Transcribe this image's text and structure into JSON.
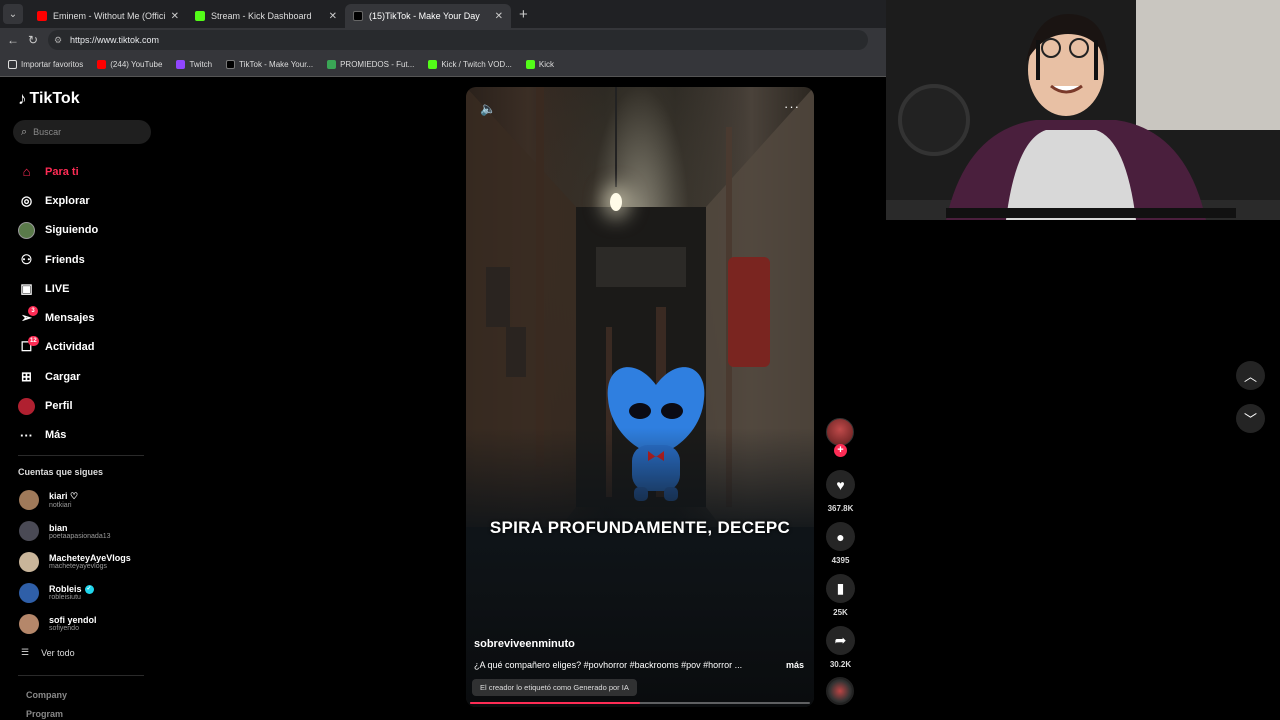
{
  "browser": {
    "tabs": [
      {
        "title": "Eminem - Without Me (Official M...",
        "favicon_color": "#ff0000",
        "active": false
      },
      {
        "title": "Stream - Kick Dashboard",
        "favicon_color": "#53fc18",
        "active": false
      },
      {
        "title": "(15)TikTok - Make Your Day",
        "favicon_color": "#000000",
        "active": true
      }
    ],
    "url": "https://www.tiktok.com",
    "bookmarks": [
      {
        "label": "Importar favoritos",
        "icon": "bookmark-import-icon",
        "color": "#ffffff"
      },
      {
        "label": "(244) YouTube",
        "icon": "youtube-icon",
        "color": "#ff0000"
      },
      {
        "label": "Twitch",
        "icon": "twitch-icon",
        "color": "#9146ff"
      },
      {
        "label": "TikTok - Make Your...",
        "icon": "tiktok-icon",
        "color": "#000000"
      },
      {
        "label": "PROMIEDOS - Fut...",
        "icon": "promiedos-icon",
        "color": "#3aa655"
      },
      {
        "label": "Kick / Twitch VOD...",
        "icon": "kick-vod-icon",
        "color": "#53fc18"
      },
      {
        "label": "Kick",
        "icon": "kick-icon",
        "color": "#53fc18"
      }
    ]
  },
  "tiktok": {
    "logo_text": "TikTok",
    "search_placeholder": "Buscar",
    "nav": [
      {
        "label": "Para ti",
        "icon": "home-icon",
        "active": true
      },
      {
        "label": "Explorar",
        "icon": "compass-icon"
      },
      {
        "label": "Siguiendo",
        "icon": "following-avatar-icon"
      },
      {
        "label": "Friends",
        "icon": "friends-icon"
      },
      {
        "label": "LIVE",
        "icon": "live-icon"
      },
      {
        "label": "Mensajes",
        "icon": "messages-icon",
        "badge": "3"
      },
      {
        "label": "Actividad",
        "icon": "activity-icon",
        "badge": "12"
      },
      {
        "label": "Cargar",
        "icon": "upload-icon"
      },
      {
        "label": "Perfil",
        "icon": "profile-avatar-icon"
      },
      {
        "label": "Más",
        "icon": "more-icon"
      }
    ],
    "following_title": "Cuentas que sigues",
    "following": [
      {
        "name": "kiari ♡",
        "handle": "notkiari",
        "color": "#a07a5a"
      },
      {
        "name": "bian",
        "handle": "poetaapasionada13",
        "color": "#4a4a55"
      },
      {
        "name": "MacheteyAyeVlogs",
        "handle": "macheteyayevlogs",
        "color": "#c9b59a"
      },
      {
        "name": "Robleis",
        "handle": "robleisiutu",
        "color": "#2f5fa8",
        "verified": true
      },
      {
        "name": "sofi yendol",
        "handle": "sofiyendo",
        "color": "#b5876a"
      }
    ],
    "see_all": "Ver todo",
    "footer": [
      "Company",
      "Program"
    ],
    "colors": {
      "accent": "#fe2c55"
    }
  },
  "video": {
    "caption_overlay": "SPIRA PROFUNDAMENTE, DECEPC",
    "author": "sobreviveenminuto",
    "description": "¿A qué compañero eliges? #povhorror #backrooms #pov #horror ...",
    "more_label": "más",
    "ai_label": "El creador lo etiquetó como Generado por IA",
    "progress": 0.5,
    "likes": "367.8K",
    "comments": "4395",
    "saves": "25K",
    "shares": "30.2K"
  }
}
